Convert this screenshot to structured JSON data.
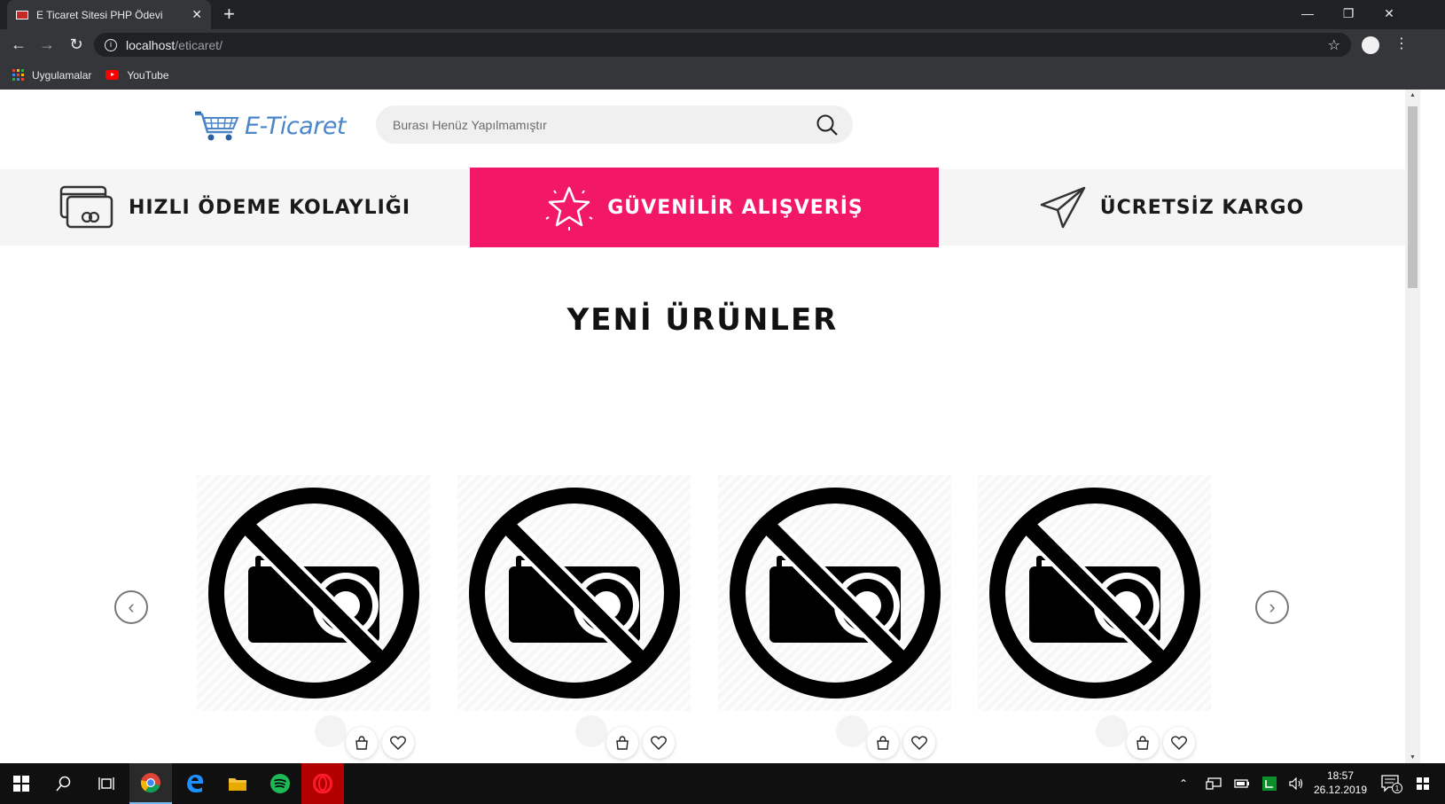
{
  "browser": {
    "tab_title": "E Ticaret Sitesi PHP Ödevi",
    "url_host": "localhost",
    "url_path": "/eticaret/",
    "bookmarks": [
      {
        "label": "Uygulamalar",
        "icon": "apps-grid-icon"
      },
      {
        "label": "YouTube",
        "icon": "youtube-icon"
      }
    ]
  },
  "site": {
    "logo_text": "E-Ticaret",
    "search_placeholder": "Burası Henüz Yapılmamıştır",
    "features": [
      {
        "label": "HIZLI ÖDEME KOLAYLIĞI",
        "icon": "credit-card-icon"
      },
      {
        "label": "GÜVENİLİR ALIŞVERİŞ",
        "icon": "star-icon"
      },
      {
        "label": "ÜCRETSİZ KARGO",
        "icon": "paper-plane-icon"
      }
    ],
    "section_title": "YENİ ÜRÜNLER",
    "products": [
      {
        "image": "no-camera-icon"
      },
      {
        "image": "no-camera-icon"
      },
      {
        "image": "no-camera-icon"
      },
      {
        "image": "no-camera-icon"
      }
    ]
  },
  "colors": {
    "accent": "#f21867",
    "logo": "#4a86c8",
    "browser_dark": "#202124",
    "browser_toolbar": "#35363a"
  },
  "taskbar": {
    "time": "18:57",
    "date": "26.12.2019",
    "notification_count": "1"
  }
}
